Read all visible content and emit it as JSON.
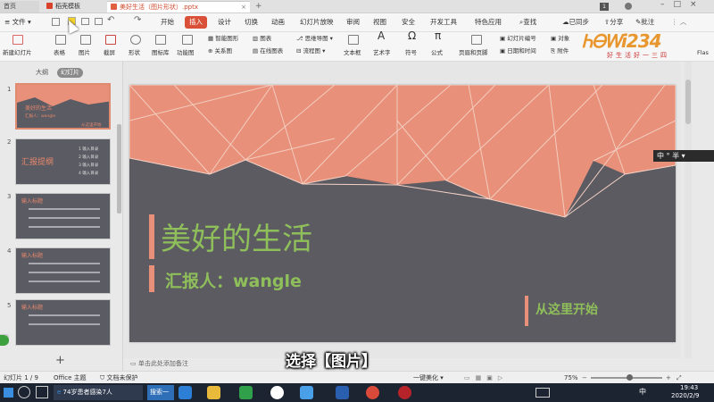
{
  "titlebar": {
    "home_tab": "首页",
    "template_tab": "稻壳模板",
    "doc_tab": "美好生活（图片形状）.pptx",
    "badge": "1"
  },
  "menu": {
    "file": "文件",
    "items": [
      "开始",
      "插入",
      "设计",
      "切换",
      "动画",
      "幻灯片放映",
      "审阅",
      "视图",
      "安全",
      "开发工具",
      "特色应用"
    ],
    "search": "查找",
    "sync": "已同步",
    "share": "分享",
    "comment": "批注"
  },
  "toolbar": {
    "new_slide": "新建幻灯片",
    "table": "表格",
    "image": "图片",
    "screenshot": "截屏",
    "shape": "形状",
    "icon_lib": "图标库",
    "func_chart": "功能图",
    "smart_shape": "智能图形",
    "chart": "图表",
    "mind_map": "思维导图",
    "relation": "关系图",
    "online_chart": "在线图表",
    "flowchart": "流程图",
    "textbox": "文本框",
    "art_text": "艺术字",
    "symbol": "符号",
    "formula": "公式",
    "header_footer": "页眉和页脚",
    "slide_number": "幻灯片编号",
    "date_time": "日期和时间",
    "object": "对象",
    "attachment": "附件",
    "flash": "Flas"
  },
  "sidepanel": {
    "tab_outline": "大纲",
    "tab_slides": "幻灯片",
    "thumbs": [
      {
        "num": "1",
        "title": "美好的生活",
        "sub": "汇报人：wangle",
        "tag": "从这里开始"
      },
      {
        "num": "2",
        "title": "汇报提纲",
        "items": [
          "1 输入目录",
          "2 输入目录",
          "3 输入目录",
          "4 输入目录"
        ]
      },
      {
        "num": "3",
        "title": "输入标题"
      },
      {
        "num": "4",
        "title": "输入标题"
      },
      {
        "num": "5",
        "title": "输入标题"
      }
    ],
    "add_label": "+"
  },
  "slide": {
    "title": "美好的生活",
    "reporter": "汇报人：wangle",
    "start": "从这里开始",
    "colors": {
      "salmon": "#e8907a",
      "dark": "#5c5b62",
      "green": "#8fbf5a",
      "accent": "#e08a70"
    }
  },
  "notes_hint": "单击此处添加备注",
  "status": {
    "slide_info": "幻灯片 1 / 9",
    "theme": "Office 主题",
    "protect": "文档未保护",
    "beautify": "一键美化",
    "zoom": "75%"
  },
  "ime": {
    "label": "中",
    "half": "半"
  },
  "watermark": "好生活好一三四",
  "caption": "选择【图片】",
  "taskbar": {
    "task_app": "74岁患者感染7人",
    "search": "搜索一下",
    "time": "19:43",
    "date": "2020/2/9",
    "ime": "中"
  }
}
